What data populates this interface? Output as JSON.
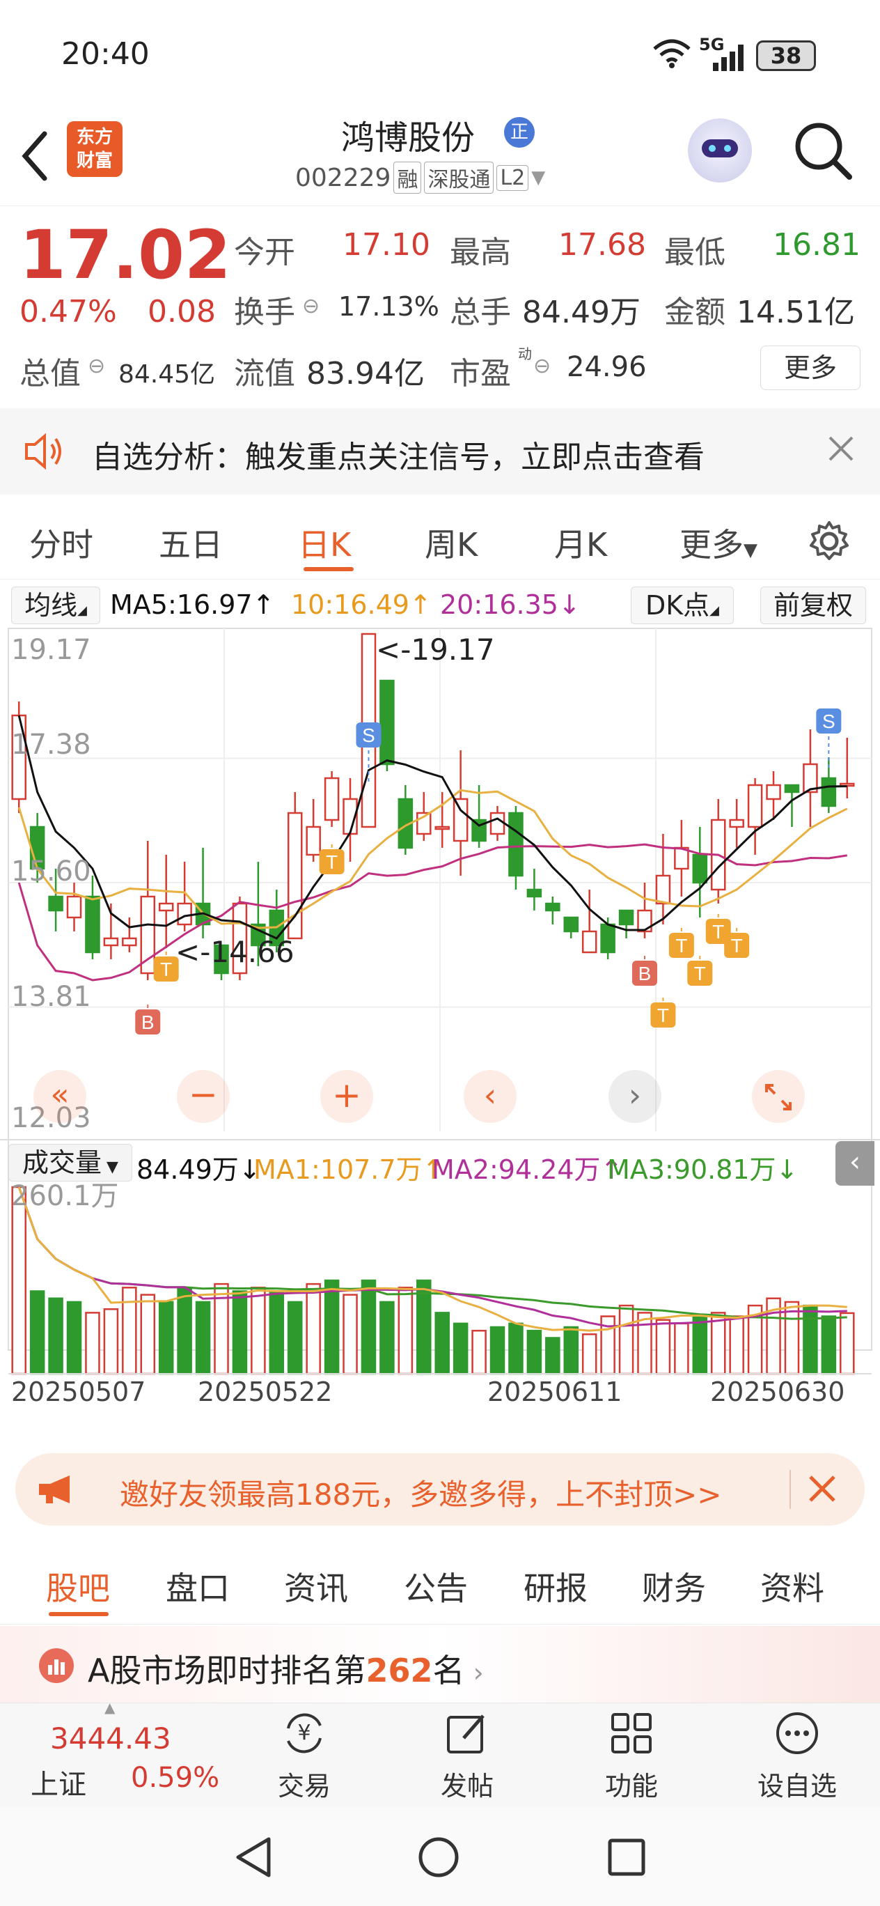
{
  "status": {
    "time": "20:40",
    "network": "5G",
    "battery": "38"
  },
  "header": {
    "title": "鸿博股份",
    "title_badge": "正",
    "code": "002229",
    "tags": [
      "融",
      "深股通",
      "L2"
    ],
    "logo_line1": "东方",
    "logo_line2": "财富"
  },
  "quote": {
    "price": "17.02",
    "change_pct": "0.47%",
    "change": "0.08",
    "open_label": "今开",
    "open": "17.10",
    "high_label": "最高",
    "high": "17.68",
    "low_label": "最低",
    "low": "16.81",
    "turnover_label": "换手",
    "turnover": "17.13%",
    "volume_label": "总手",
    "volume": "84.49万",
    "amount_label": "金额",
    "amount": "14.51亿",
    "mcap_label": "总值",
    "mcap": "84.45亿",
    "float_label": "流值",
    "float": "83.94亿",
    "pe_label": "市盈",
    "pe_sup": "动",
    "pe": "24.96",
    "more": "更多"
  },
  "banner1": {
    "text": "自选分析：触发重点关注信号，立即点击查看"
  },
  "tabs": [
    "分时",
    "五日",
    "日K",
    "周K",
    "月K",
    "更多"
  ],
  "active_tab": "日K",
  "kbar": {
    "ma_label": "均线",
    "ma5": "MA5:16.97↑",
    "ma10": "10:16.49↑",
    "ma20": "20:16.35↓",
    "dk": "DK点",
    "adjust": "前复权"
  },
  "chart_data": {
    "type": "candlestick",
    "ylim": [
      12.03,
      19.17
    ],
    "price_ticks": [
      "19.17",
      "17.38",
      "15.60",
      "13.81",
      "12.03"
    ],
    "x_labels": [
      "20250507",
      "20250522",
      "20250611",
      "20250630"
    ],
    "annotations": {
      "max": "<-19.17",
      "min": "<-14.66"
    },
    "signals": [
      "B",
      "T",
      "S"
    ],
    "candles": [
      [
        16.8,
        18.0,
        16.6,
        18.2
      ],
      [
        16.4,
        15.8,
        15.6,
        16.6
      ],
      [
        15.4,
        15.2,
        14.9,
        15.8
      ],
      [
        15.1,
        15.4,
        14.9,
        15.6
      ],
      [
        15.4,
        14.6,
        14.5,
        15.7
      ],
      [
        14.7,
        14.8,
        14.5,
        15.3
      ],
      [
        14.7,
        14.8,
        14.6,
        15.1
      ],
      [
        14.3,
        15.4,
        14.2,
        16.2
      ],
      [
        15.2,
        15.3,
        14.66,
        16.0
      ],
      [
        15.0,
        15.3,
        14.9,
        15.9
      ],
      [
        15.3,
        15.0,
        14.8,
        16.1
      ],
      [
        14.7,
        14.3,
        14.2,
        14.7
      ],
      [
        14.3,
        15.3,
        14.2,
        15.4
      ],
      [
        15.0,
        14.7,
        14.4,
        15.9
      ],
      [
        15.2,
        14.7,
        14.6,
        15.5
      ],
      [
        14.8,
        16.6,
        14.8,
        16.9
      ],
      [
        16.0,
        16.4,
        15.9,
        16.8
      ],
      [
        16.5,
        17.1,
        16.4,
        17.2
      ],
      [
        16.3,
        16.8,
        15.9,
        17.1
      ],
      [
        16.4,
        19.17,
        16.4,
        19.17
      ],
      [
        18.5,
        17.3,
        17.2,
        18.5
      ],
      [
        16.8,
        16.1,
        16.0,
        17.0
      ],
      [
        16.3,
        16.6,
        16.2,
        16.9
      ],
      [
        16.4,
        16.4,
        16.1,
        16.9
      ],
      [
        16.2,
        16.8,
        15.7,
        17.5
      ],
      [
        16.5,
        16.2,
        16.1,
        17.0
      ],
      [
        16.3,
        16.6,
        16.2,
        16.7
      ],
      [
        16.6,
        15.7,
        15.5,
        16.7
      ],
      [
        15.5,
        15.4,
        15.2,
        15.8
      ],
      [
        15.3,
        15.2,
        15.0,
        15.4
      ],
      [
        15.1,
        14.9,
        14.8,
        15.1
      ],
      [
        14.6,
        14.9,
        14.6,
        15.5
      ],
      [
        15.0,
        14.6,
        14.5,
        15.1
      ],
      [
        15.2,
        15.0,
        14.8,
        15.2
      ],
      [
        14.9,
        15.2,
        14.8,
        15.6
      ],
      [
        15.3,
        15.7,
        15.0,
        16.3
      ],
      [
        15.8,
        16.1,
        15.4,
        16.5
      ],
      [
        16.0,
        15.6,
        15.1,
        16.4
      ],
      [
        15.5,
        16.5,
        15.3,
        16.8
      ],
      [
        16.4,
        16.5,
        16.1,
        16.8
      ],
      [
        16.4,
        17.0,
        16.0,
        17.1
      ],
      [
        16.8,
        17.0,
        16.5,
        17.2
      ],
      [
        17.0,
        16.9,
        16.4,
        17.0
      ],
      [
        16.9,
        17.3,
        16.4,
        17.8
      ],
      [
        17.1,
        16.7,
        16.6,
        17.4
      ],
      [
        17.02,
        17.02,
        16.81,
        17.68
      ]
    ],
    "volume_max": "260.1万",
    "volumes": [
      [
        260,
        1
      ],
      [
        115,
        0
      ],
      [
        105,
        0
      ],
      [
        100,
        0
      ],
      [
        85,
        1
      ],
      [
        90,
        1
      ],
      [
        120,
        1
      ],
      [
        110,
        1
      ],
      [
        100,
        0
      ],
      [
        120,
        0
      ],
      [
        100,
        0
      ],
      [
        125,
        1
      ],
      [
        115,
        0
      ],
      [
        120,
        1
      ],
      [
        115,
        0
      ],
      [
        100,
        0
      ],
      [
        125,
        1
      ],
      [
        130,
        0
      ],
      [
        110,
        1
      ],
      [
        130,
        0
      ],
      [
        100,
        0
      ],
      [
        120,
        1
      ],
      [
        130,
        0
      ],
      [
        85,
        0
      ],
      [
        70,
        0
      ],
      [
        60,
        1
      ],
      [
        65,
        0
      ],
      [
        70,
        0
      ],
      [
        60,
        0
      ],
      [
        50,
        0
      ],
      [
        65,
        0
      ],
      [
        55,
        1
      ],
      [
        80,
        1
      ],
      [
        95,
        1
      ],
      [
        85,
        1
      ],
      [
        75,
        1
      ],
      [
        70,
        1
      ],
      [
        80,
        0
      ],
      [
        85,
        1
      ],
      [
        80,
        1
      ],
      [
        95,
        1
      ],
      [
        105,
        1
      ],
      [
        100,
        1
      ],
      [
        95,
        0
      ],
      [
        80,
        0
      ],
      [
        84.49,
        1
      ]
    ]
  },
  "volbar": {
    "label": "成交量",
    "vol": "84.49万↓",
    "ma1": "MA1:107.7万↑",
    "ma2": "MA2:94.24万↑",
    "ma3": "MA3:90.81万↓"
  },
  "invite": {
    "text": "邀好友领最高188元，多邀多得，上不封顶>>"
  },
  "ftabs": [
    "股吧",
    "盘口",
    "资讯",
    "公告",
    "研报",
    "财务",
    "资料"
  ],
  "rank": {
    "prefix": "A股市场即时排名第",
    "num": "262",
    "suffix": "名"
  },
  "bottom": {
    "index_val": "3444.43",
    "index_name": "上证",
    "index_pct": "0.59%",
    "items": [
      "交易",
      "发帖",
      "功能",
      "设自选"
    ]
  },
  "colors": {
    "up": "#d43c33",
    "down": "#2e9a2e",
    "ma5": "#111111",
    "ma10": "#e8b040",
    "ma20": "#c0307e"
  }
}
